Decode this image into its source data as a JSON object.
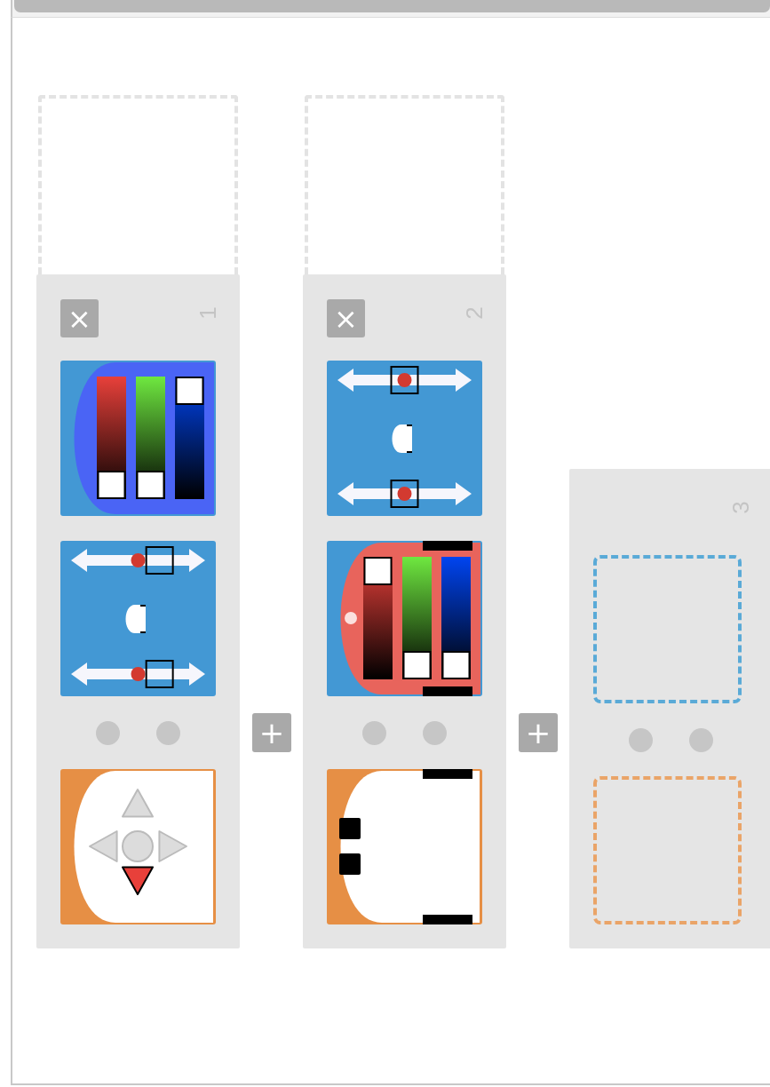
{
  "columns": [
    {
      "kind": "rule",
      "number": "1",
      "delete_label": "×",
      "add_label": "+",
      "actions": [
        {
          "kind": "color_top",
          "channels": [
            {
              "level": 0
            },
            {
              "level": 0
            },
            {
              "level": 1
            }
          ]
        },
        {
          "kind": "motors",
          "motors": [
            {
              "level": 0.66
            },
            {
              "level": 0.66
            }
          ]
        }
      ],
      "event": {
        "kind": "buttons",
        "buttons": [
          {
            "selected": false
          },
          {
            "selected": false
          },
          {
            "selected": false
          },
          {
            "selected": false
          },
          {
            "selected": true
          }
        ]
      }
    },
    {
      "kind": "rule",
      "number": "2",
      "delete_label": "×",
      "add_label": "+",
      "actions": [
        {
          "kind": "motors",
          "motors": [
            {
              "level": 0.5
            },
            {
              "level": 0.5
            }
          ]
        },
        {
          "kind": "color_bottom",
          "channels": [
            {
              "level": 1
            },
            {
              "level": 0
            },
            {
              "level": 0
            }
          ]
        }
      ],
      "event": {
        "kind": "sensors",
        "sensors": [
          {
            "active": true
          },
          {
            "active": true
          }
        ]
      }
    },
    {
      "kind": "new",
      "number": "3",
      "actions": [
        {
          "kind": "empty"
        }
      ],
      "event": {
        "kind": "empty"
      }
    }
  ]
}
